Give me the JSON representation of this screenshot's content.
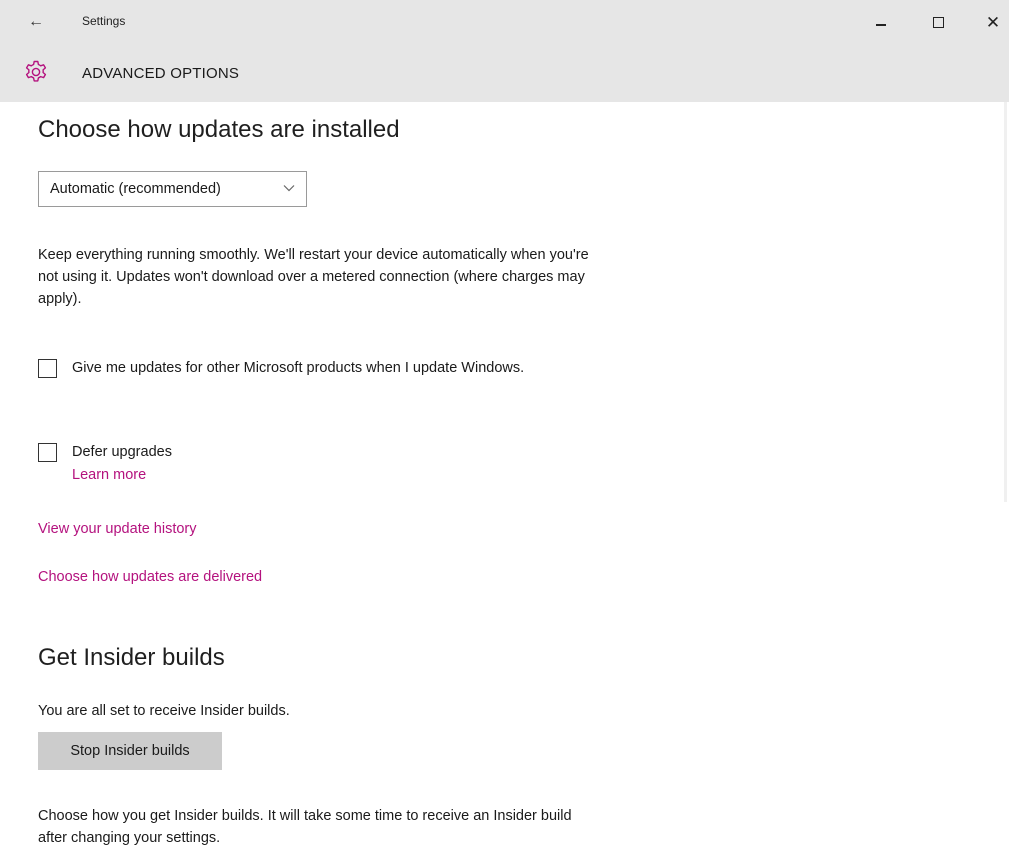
{
  "window": {
    "title": "Settings",
    "back_icon": "back-arrow-icon",
    "controls": [
      "minimize-icon",
      "maximize-icon",
      "close-icon"
    ]
  },
  "header": {
    "icon": "gear-icon",
    "title": "ADVANCED OPTIONS",
    "accent_color": "#b4127e"
  },
  "updates": {
    "heading": "Choose how updates are installed",
    "dropdown": {
      "selected": "Automatic (recommended)"
    },
    "description": "Keep everything running smoothly. We'll restart your device automatically when you're not using it. Updates won't download over a metered connection (where charges may apply).",
    "checkboxes": [
      {
        "label": "Give me updates for other Microsoft products when I update Windows.",
        "checked": false
      },
      {
        "label": "Defer upgrades",
        "checked": false
      }
    ],
    "learn_more": "Learn more",
    "links": {
      "history": "View your update history",
      "delivery": "Choose how updates are delivered"
    }
  },
  "insider": {
    "heading": "Get Insider builds",
    "status": "You are all set to receive Insider builds.",
    "button": "Stop Insider builds",
    "description": "Choose how you get Insider builds. It will take some time to receive an Insider build after changing your settings."
  },
  "colors": {
    "titlebar_bg": "#e6e6e6",
    "link": "#b4127e",
    "button_bg": "#cccccc"
  }
}
